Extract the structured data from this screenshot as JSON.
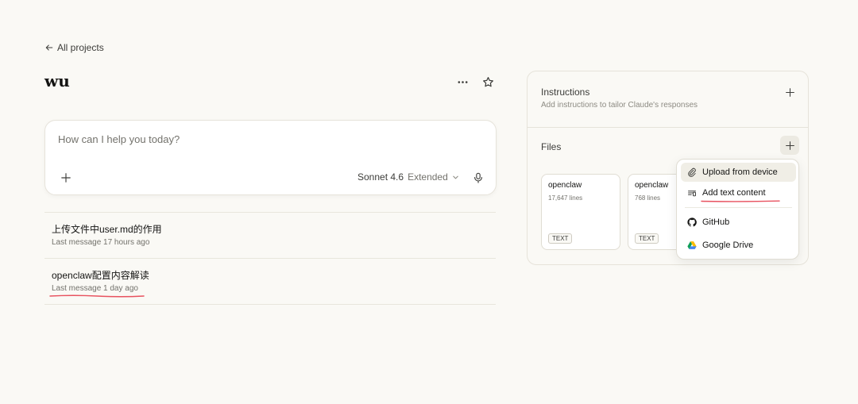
{
  "nav": {
    "back_label": "All projects"
  },
  "project": {
    "title": "wu"
  },
  "composer": {
    "placeholder": "How can I help you today?",
    "model_name": "Sonnet 4.6",
    "model_mode": "Extended"
  },
  "conversations": [
    {
      "title": "上传文件中user.md的作用",
      "meta": "Last message 17 hours ago"
    },
    {
      "title": "openclaw配置内容解读",
      "meta": "Last message 1 day ago"
    }
  ],
  "panel": {
    "instructions": {
      "heading": "Instructions",
      "subtitle": "Add instructions to tailor Claude's responses"
    },
    "files": {
      "heading": "Files",
      "items": [
        {
          "name": "openclaw",
          "lines": "17,647 lines",
          "type": "TEXT"
        },
        {
          "name": "openclaw",
          "lines": "768 lines",
          "type": "TEXT"
        }
      ]
    }
  },
  "dropdown": {
    "items": [
      {
        "label": "Upload from device",
        "icon": "paperclip-icon"
      },
      {
        "label": "Add text content",
        "icon": "text-content-icon"
      },
      {
        "label": "GitHub",
        "icon": "github-icon"
      },
      {
        "label": "Google Drive",
        "icon": "google-drive-icon"
      }
    ]
  },
  "colors": {
    "background": "#faf9f5",
    "annotation_red": "#e8525f"
  }
}
